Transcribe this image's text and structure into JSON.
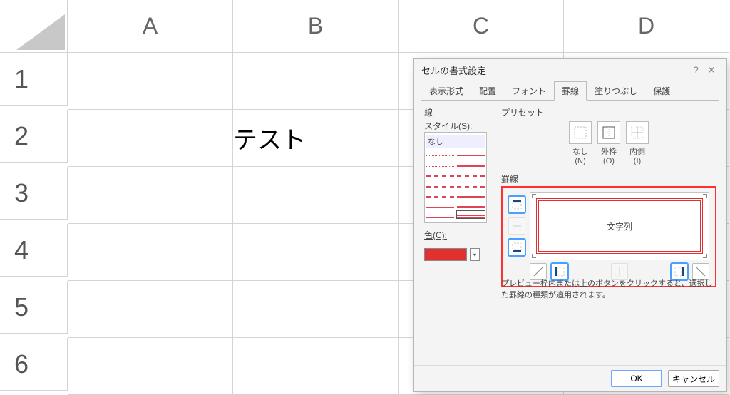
{
  "sheet": {
    "columns": [
      "A",
      "B",
      "C",
      "D"
    ],
    "rows": [
      "1",
      "2",
      "3",
      "4",
      "5",
      "6"
    ],
    "b2_text": "テスト"
  },
  "dialog": {
    "title": "セルの書式設定",
    "help_icon": "?",
    "close_icon": "✕",
    "tabs": [
      "表示形式",
      "配置",
      "フォント",
      "罫線",
      "塗りつぶし",
      "保護"
    ],
    "active_tab_index": 3,
    "line_group": "線",
    "style_label": "スタイル(S):",
    "style_none": "なし",
    "color_label": "色(C):",
    "selected_color": "#e03030",
    "preset_group": "プリセット",
    "preset_labels": {
      "none": "なし(N)",
      "outer": "外枠(O)",
      "inner": "内側(I)"
    },
    "border_group": "罫線",
    "preview_text": "文字列",
    "hint_text": "プレビュー枠内または上のボタンをクリックすると、選択した罫線の種類が適用されます。",
    "ok": "OK",
    "cancel": "キャンセル"
  }
}
